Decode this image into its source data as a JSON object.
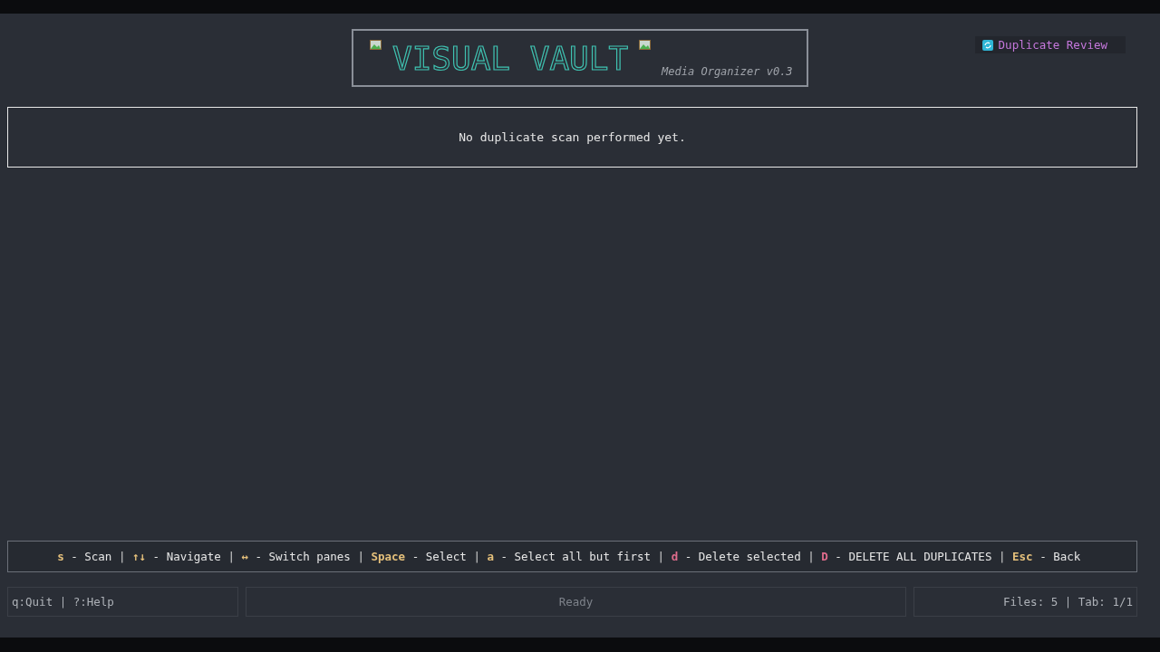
{
  "header": {
    "logo": "VISUAL VAULT",
    "subtitle": "Media Organizer v0.3"
  },
  "mode_badge": {
    "label": "Duplicate Review"
  },
  "main_panel": {
    "message": "No duplicate scan performed yet."
  },
  "key_hint_separator": "|",
  "key_hints": [
    {
      "key": "s",
      "action": "- Scan",
      "color": "#e5c07b"
    },
    {
      "key": "↑↓",
      "action": "- Navigate",
      "color": "#e5c07b"
    },
    {
      "key": "↔",
      "action": "- Switch panes",
      "color": "#e5c07b"
    },
    {
      "key": "Space",
      "action": "- Select",
      "color": "#e5c07b"
    },
    {
      "key": "a",
      "action": "- Select all but first",
      "color": "#e5c07b"
    },
    {
      "key": "d",
      "action": "- Delete selected",
      "color": "#e06c8c"
    },
    {
      "key": "D",
      "action": "- DELETE ALL DUPLICATES",
      "color": "#e06c8c"
    },
    {
      "key": "Esc",
      "action": "- Back",
      "color": "#e5c07b"
    }
  ],
  "status_bar": {
    "left": "q:Quit | ?:Help",
    "center": "Ready",
    "right": "Files: 5 | Tab: 1/1"
  }
}
